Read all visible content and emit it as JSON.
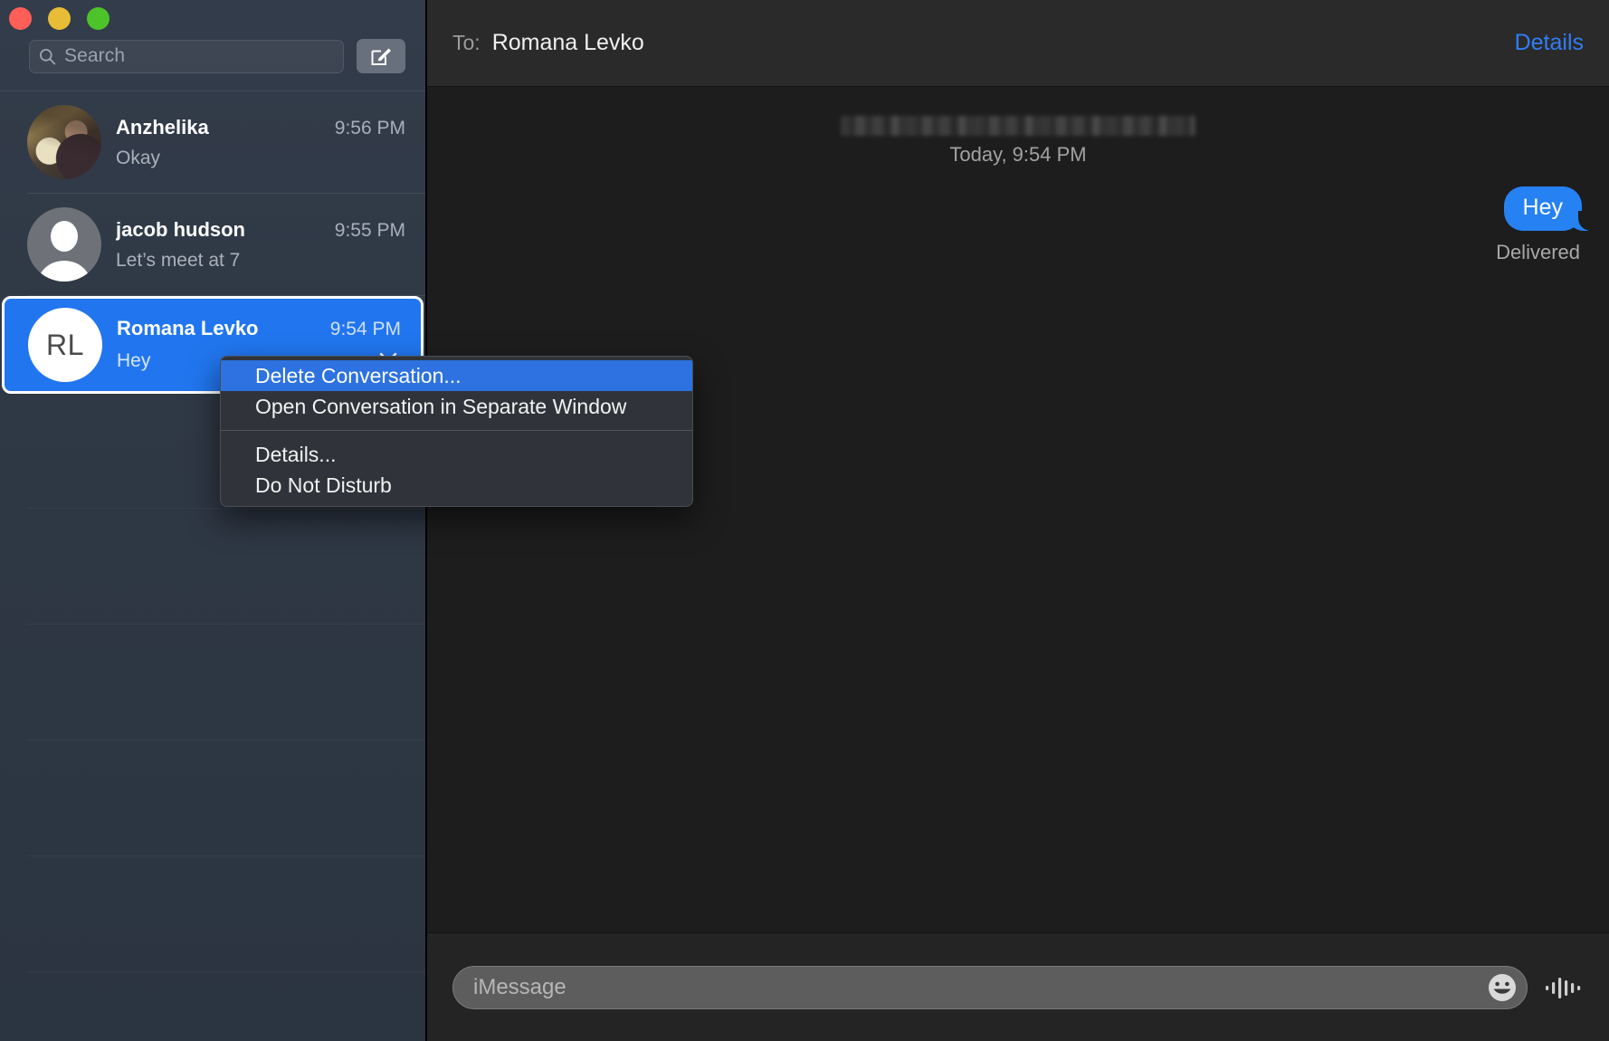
{
  "window": {
    "traffic_lights": [
      {
        "name": "close",
        "color": "#ff5f57"
      },
      {
        "name": "minimize",
        "color": "#e7bc36"
      },
      {
        "name": "zoom",
        "color": "#4cc328"
      }
    ]
  },
  "sidebar": {
    "search": {
      "placeholder": "Search",
      "value": "",
      "icon": "search-icon"
    },
    "compose_button": {
      "icon": "compose-icon",
      "label": ""
    },
    "conversations": [
      {
        "name": "Anzhelika",
        "time": "9:56 PM",
        "preview": "Okay",
        "avatar_type": "photo",
        "initials": "",
        "selected": false
      },
      {
        "name": "jacob hudson",
        "time": "9:55 PM",
        "preview": "Let’s meet at 7",
        "avatar_type": "person",
        "initials": "",
        "selected": false
      },
      {
        "name": "Romana Levko",
        "time": "9:54 PM",
        "preview": "Hey",
        "avatar_type": "initials",
        "initials": "RL",
        "selected": true,
        "close_icon": "close-icon"
      }
    ]
  },
  "context_menu": {
    "groups": [
      {
        "items": [
          {
            "label": "Delete Conversation...",
            "highlighted": true
          },
          {
            "label": "Open Conversation in Separate Window",
            "highlighted": false
          }
        ]
      },
      {
        "items": [
          {
            "label": "Details...",
            "highlighted": false
          },
          {
            "label": "Do Not Disturb",
            "highlighted": false
          }
        ]
      }
    ]
  },
  "chat": {
    "to_label": "To:",
    "recipient": "Romana Levko",
    "details_link": "Details",
    "redacted_line": "",
    "day_stamp": "Today, 9:54 PM",
    "messages": [
      {
        "text": "Hey",
        "side": "outgoing",
        "status": "Delivered"
      }
    ],
    "compose": {
      "placeholder": "iMessage",
      "value": "",
      "emoji_icon": "smiley-icon",
      "audio_icon": "audio-waveform-icon"
    }
  },
  "colors": {
    "accent_blue": "#2176ef",
    "bubble_blue": "#2681f2",
    "link_blue": "#2f7ef5",
    "menu_highlight": "#2d72e0",
    "sidebar_bg": "#2f3845",
    "chat_bg": "#1d1d1d"
  }
}
